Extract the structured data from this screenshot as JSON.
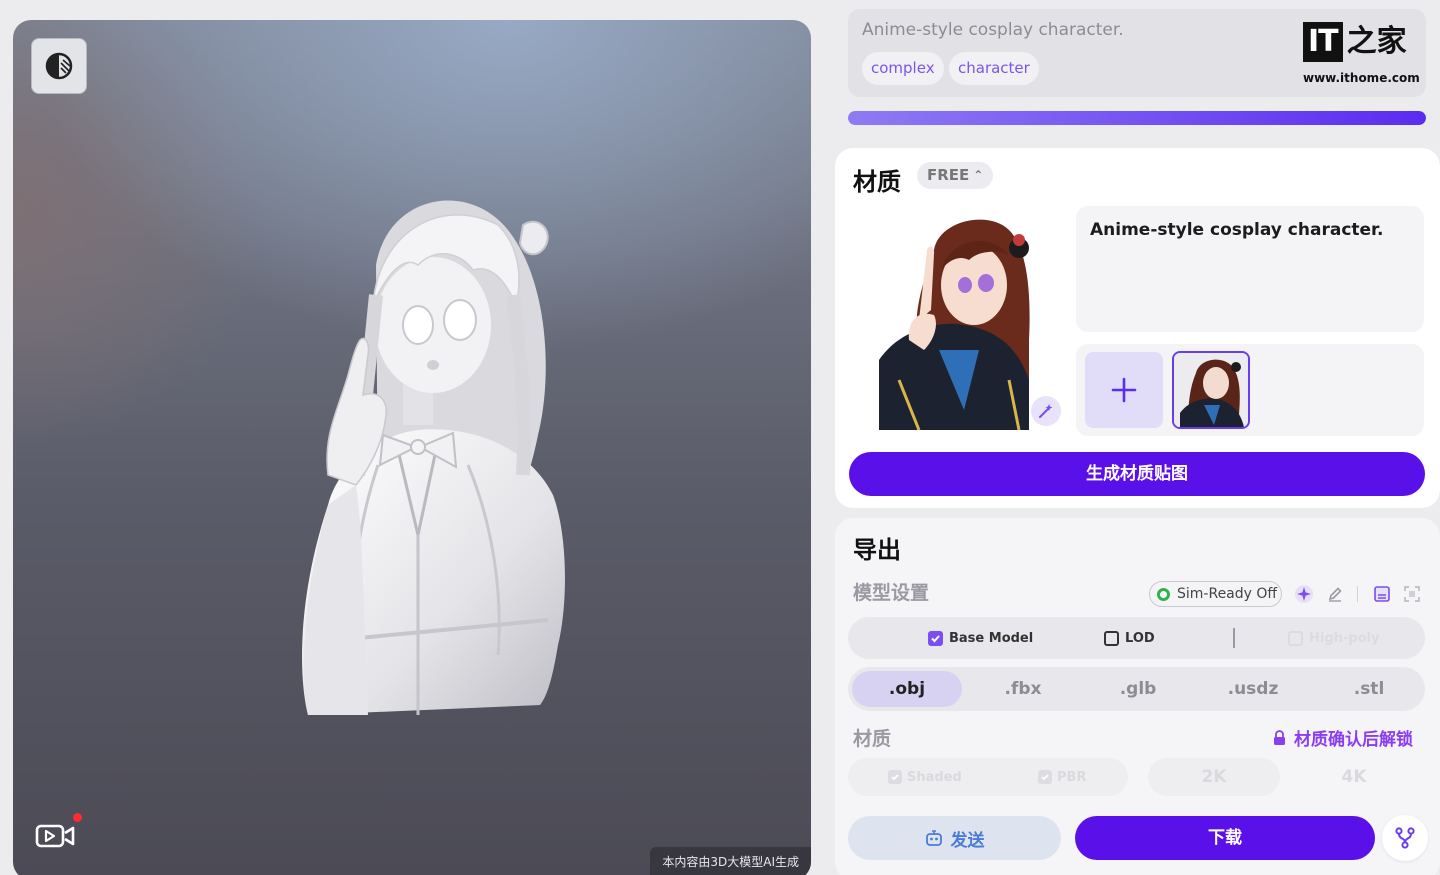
{
  "viewport": {
    "ai_notice": "本内容由3D大模型AI生成"
  },
  "prompt_card": {
    "prompt": "Anime-style cosplay character.",
    "tags": [
      "complex",
      "character"
    ],
    "logo_mark": "IT",
    "logo_zh": "之家",
    "logo_url": "www.ithome.com"
  },
  "progress": {
    "percent": 100
  },
  "material": {
    "title": "材质",
    "badge": "FREE",
    "description": "Anime-style cosplay character.",
    "generate_label": "生成材质贴图"
  },
  "export": {
    "title": "导出",
    "model_settings_label": "模型设置",
    "sim_ready": "Sim-Ready Off",
    "options": {
      "base_model": "Base Model",
      "lod": "LOD",
      "high_poly": "High-poly"
    },
    "formats": [
      ".obj",
      ".fbx",
      ".glb",
      ".usdz",
      ".stl"
    ],
    "material_label": "材质",
    "unlock_text": "材质确认后解锁",
    "texture_options": {
      "shaded": "Shaded",
      "pbr": "PBR",
      "res_2k": "2K",
      "res_4k": "4K"
    },
    "send_label": "发送",
    "download_label": "下载"
  },
  "colors": {
    "accent": "#5a10e8",
    "tag_text": "#7c55e8",
    "unlock": "#8a3ef0",
    "sim_ready_indicator": "#2fb24a"
  },
  "icons": {
    "view_mode": "half-circle-contrast-icon",
    "record": "video-record-icon",
    "magic": "magic-wand-icon",
    "add": "plus-icon",
    "sparkle": "sparkle-icon",
    "edit": "pencil-icon",
    "save": "save-icon",
    "fit": "frame-icon",
    "lock": "lock-icon",
    "send": "bot-icon",
    "fork": "fork-icon"
  }
}
